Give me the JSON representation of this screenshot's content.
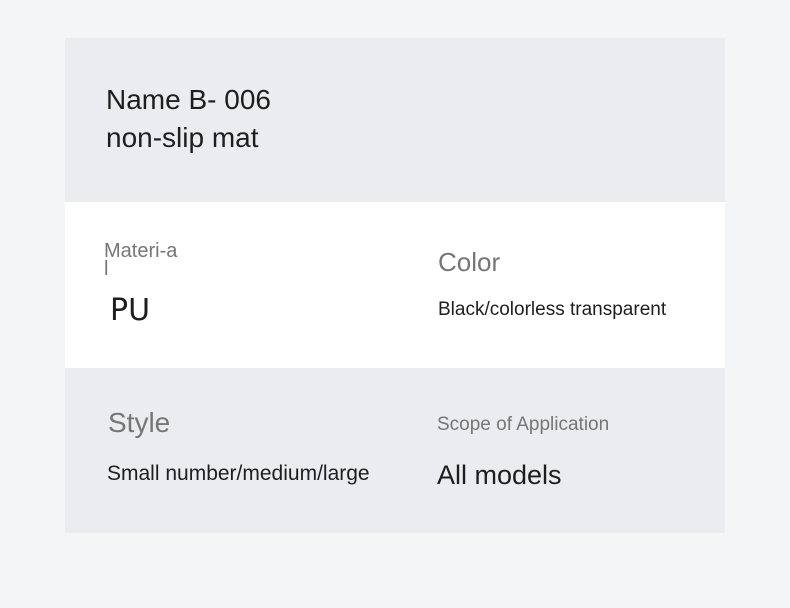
{
  "product": {
    "title_line1": "Name B- 006",
    "title_line2": "non-slip mat"
  },
  "specs": {
    "material_label": "Materi-al",
    "material_value": "PU",
    "color_label": "Color",
    "color_value": "Black/colorless transparent",
    "style_label": "Style",
    "style_value": "Small number/medium/large",
    "scope_label": "Scope of Application",
    "scope_value": "All models"
  },
  "colors": {
    "page_background": "#f4f5f7",
    "band_gray": "#ebecf0",
    "band_white": "#ffffff",
    "label_text": "#767676",
    "value_text": "#1e1e1e"
  }
}
